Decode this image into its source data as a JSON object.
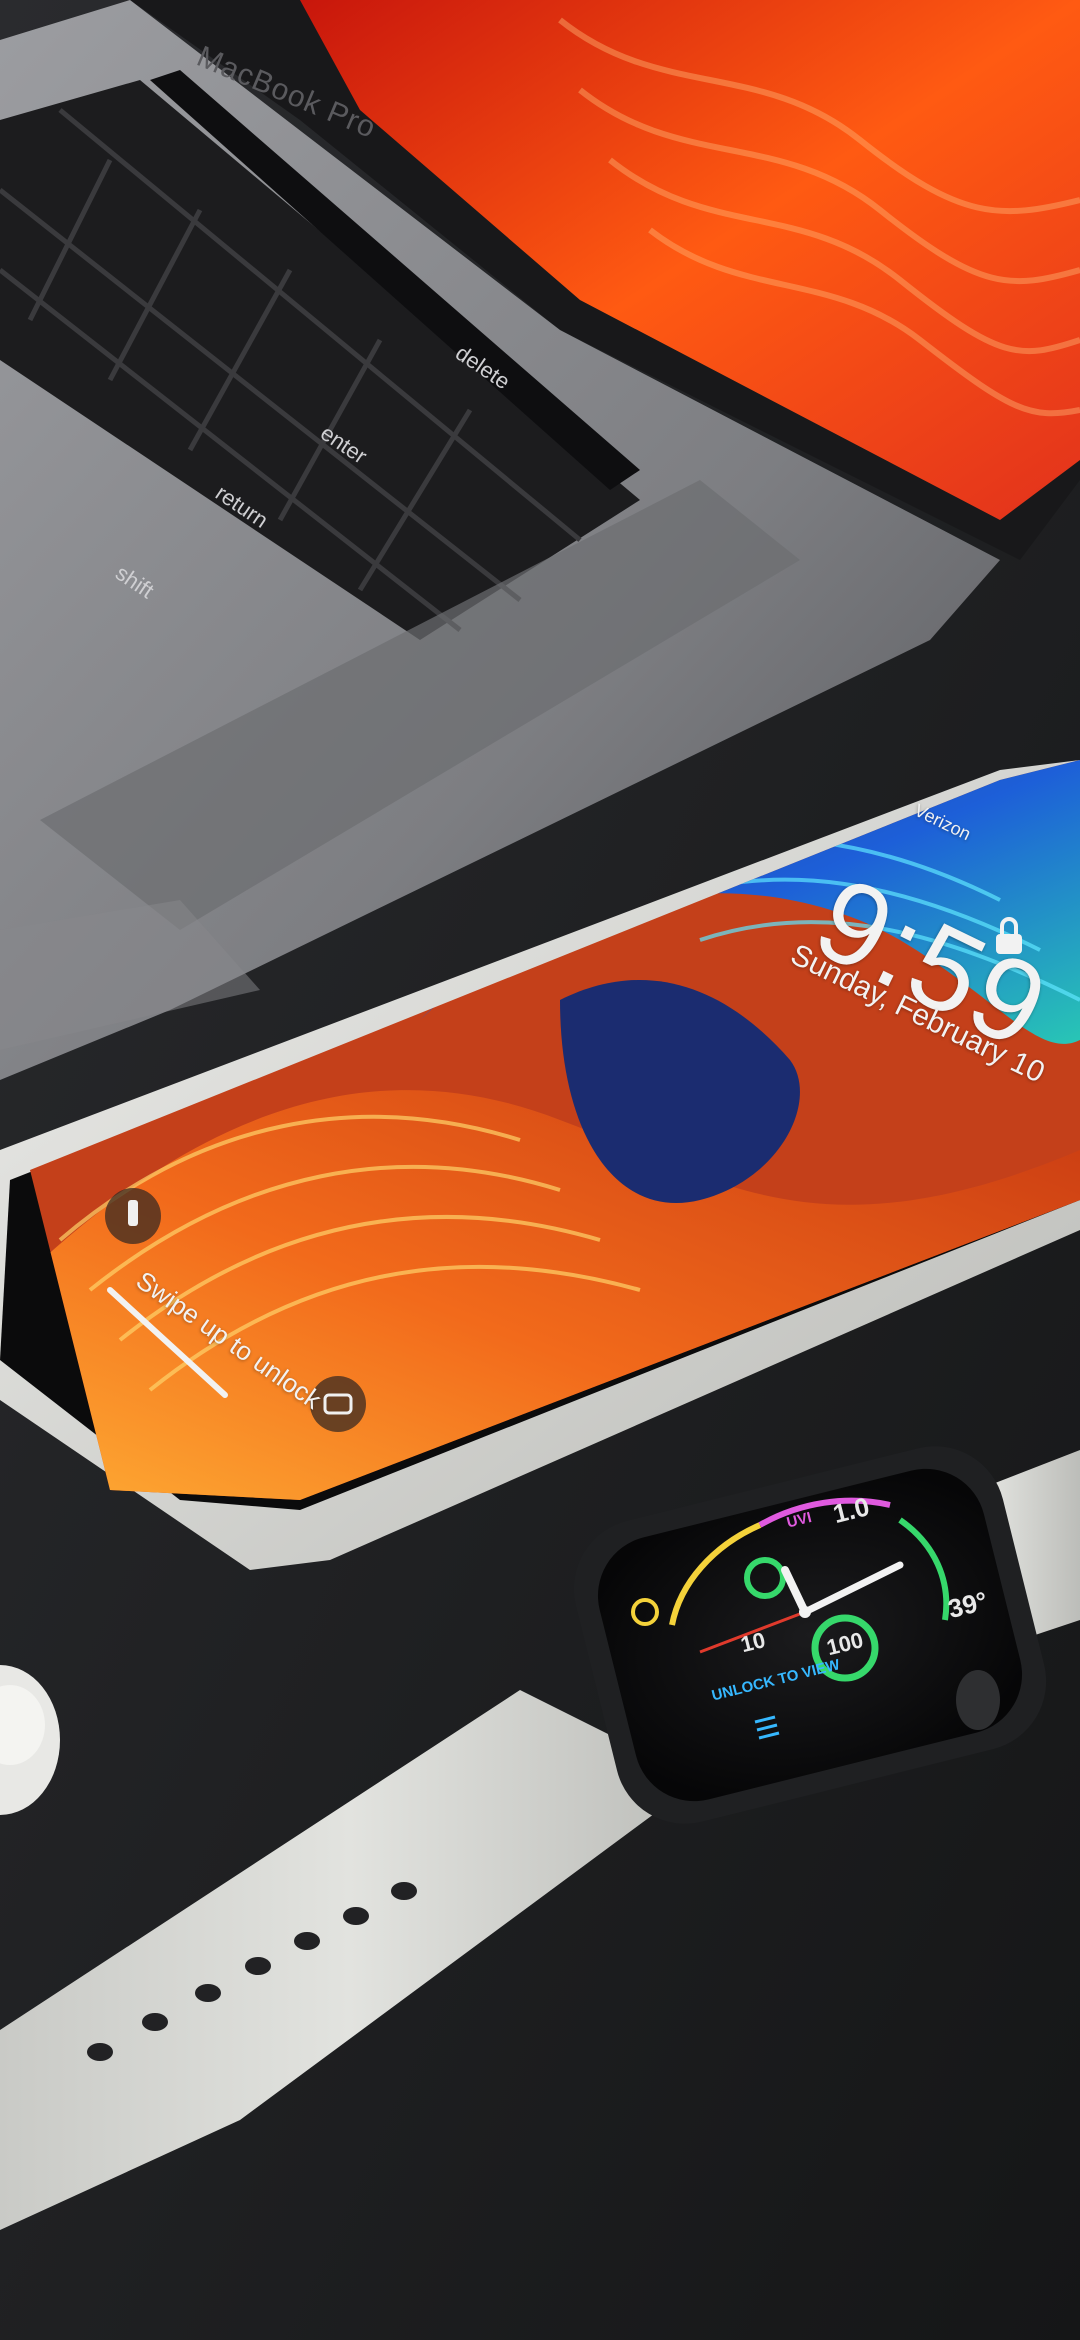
{
  "laptop": {
    "brand": "MacBook Pro",
    "keys": {
      "return": "return",
      "enter": "enter",
      "shift": "shift",
      "delete": "delete"
    }
  },
  "phone": {
    "carrier": "Verizon",
    "time": "9:59",
    "date": "Sunday, February 10",
    "swipe_hint": "Swipe up to unlock"
  },
  "watch": {
    "top_value": "1.0",
    "uvi_label": "UVI",
    "temp": "39°",
    "day_number": "10",
    "center_value": "100",
    "unlock_hint": "UNLOCK TO VIEW"
  },
  "colors": {
    "background": "#1f2022",
    "laptop_body": "#8a8b8f",
    "laptop_keys": "#1c1c1e",
    "laptop_display_red": "#e2321c",
    "laptop_display_orange": "#ff7a1f",
    "phone_frame": "#d9dad6",
    "wallpaper_orange": "#f26a1b",
    "wallpaper_blue": "#1d5fd8",
    "wallpaper_teal": "#28c6b5",
    "watch_band": "#d6d7d3",
    "watch_case": "#202123"
  }
}
